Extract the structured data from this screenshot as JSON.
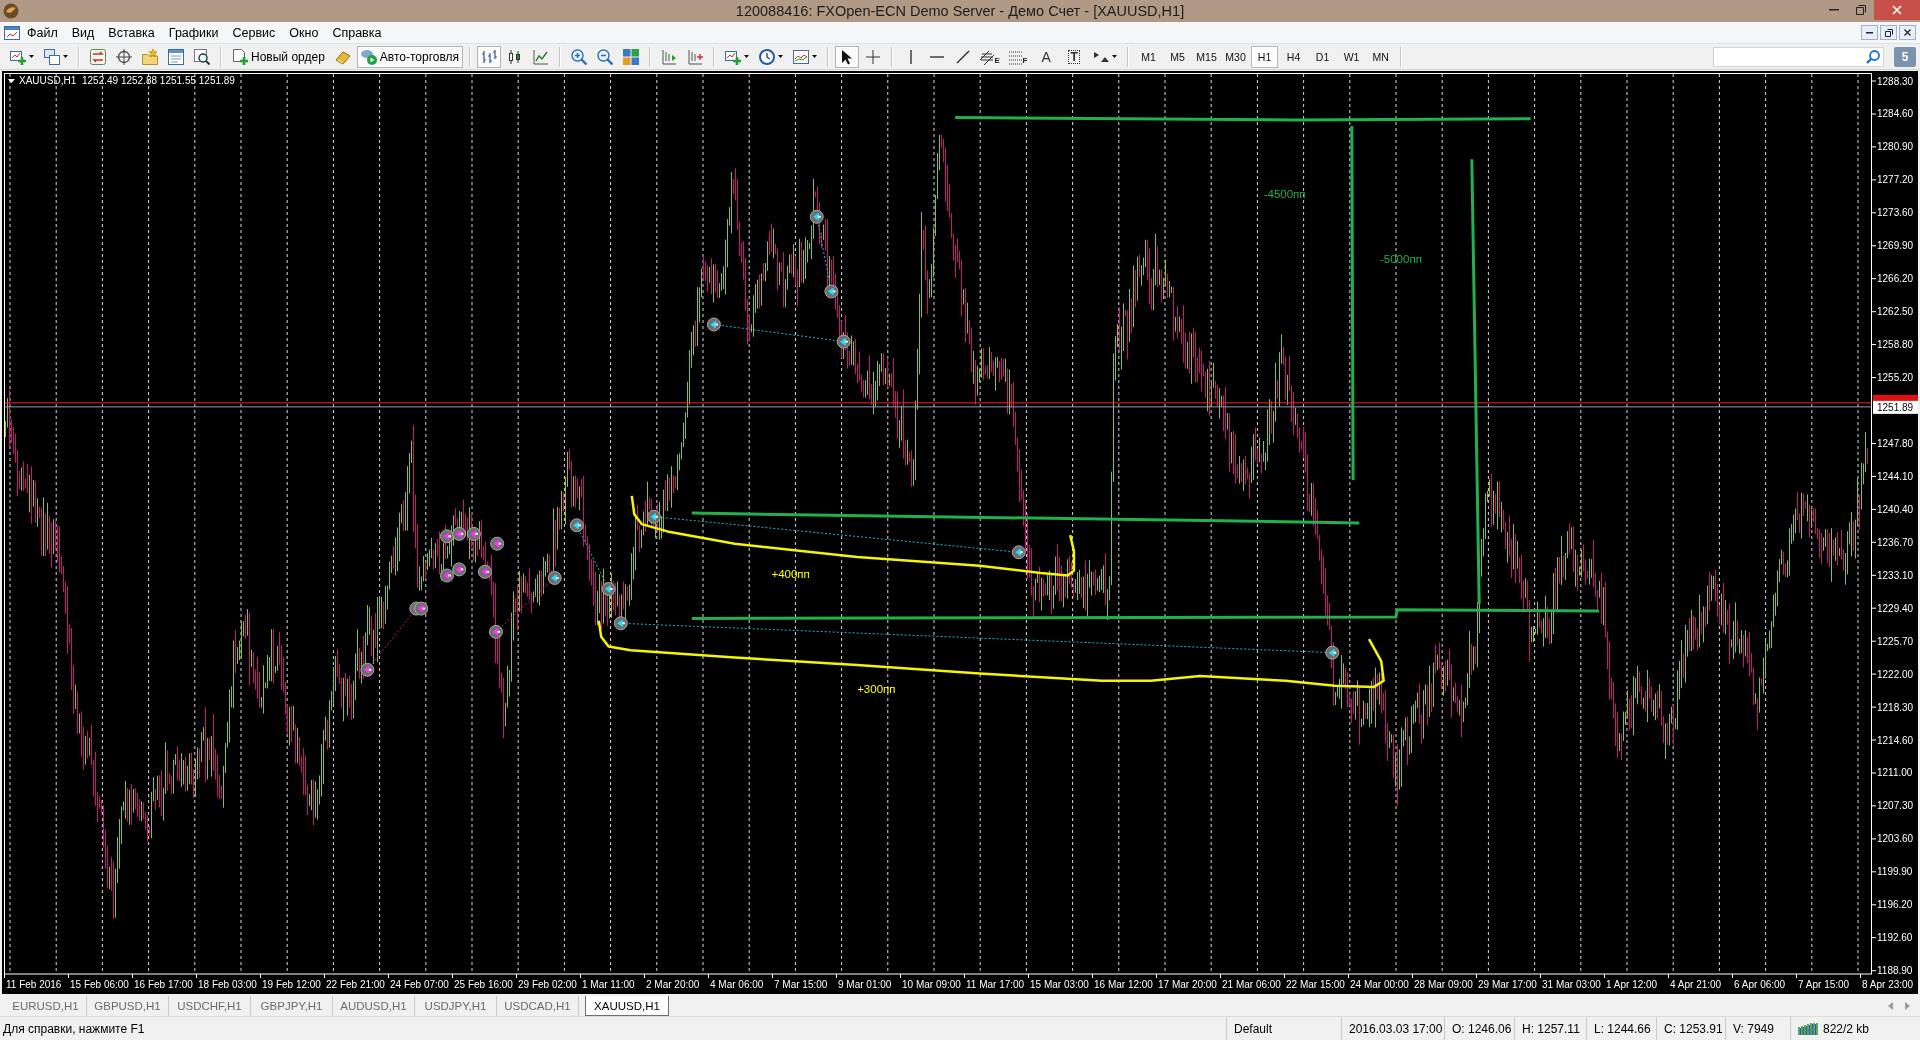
{
  "window": {
    "title": "120088416: FXOpen-ECN Demo Server - Демо Счет - [XAUUSD,H1]"
  },
  "menu": [
    "Файл",
    "Вид",
    "Вставка",
    "Графики",
    "Сервис",
    "Окно",
    "Справка"
  ],
  "toolbar": {
    "new_order": "Новый ордер",
    "auto_trading": {
      "label": "Авто-торговля",
      "on": true
    },
    "chart_modes": [
      {
        "selected": true
      },
      {
        "selected": false
      },
      {
        "selected": false
      }
    ],
    "cursor_modes": [
      {
        "selected": true
      },
      {
        "selected": false
      }
    ],
    "tool_letters": [
      "E",
      "F",
      "A",
      "T"
    ],
    "timeframes": [
      {
        "label": "M1",
        "selected": false
      },
      {
        "label": "M5",
        "selected": false
      },
      {
        "label": "M15",
        "selected": false
      },
      {
        "label": "M30",
        "selected": false
      },
      {
        "label": "H1",
        "selected": true
      },
      {
        "label": "H4",
        "selected": false
      },
      {
        "label": "D1",
        "selected": false
      },
      {
        "label": "W1",
        "selected": false
      },
      {
        "label": "MN",
        "selected": false
      }
    ],
    "messages": "5"
  },
  "chart": {
    "symbol": "XAUUSD,H1",
    "quote": "1252.49 1252.88 1251.55 1251.89",
    "price_labels": [
      "1288.30",
      "1284.60",
      "1280.90",
      "1277.20",
      "1273.60",
      "1269.90",
      "1266.20",
      "1262.50",
      "1258.80",
      "1255.20",
      "1247.80",
      "1244.10",
      "1240.40",
      "1236.70",
      "1233.10",
      "1229.40",
      "1225.70",
      "1222.00",
      "1218.30",
      "1214.60",
      "1211.00",
      "1207.30",
      "1203.60",
      "1199.90",
      "1196.20",
      "1192.60",
      "1188.90"
    ],
    "current_price": "1251.89",
    "time_labels": [
      "11 Feb 2016",
      "15 Feb 06:00",
      "16 Feb 17:00",
      "18 Feb 03:00",
      "19 Feb 12:00",
      "22 Feb 21:00",
      "24 Feb 07:00",
      "25 Feb 16:00",
      "29 Feb 02:00",
      "1 Mar 11:00",
      "2 Mar 20:00",
      "4 Mar 06:00",
      "7 Mar 15:00",
      "9 Mar 01:00",
      "10 Mar 09:00",
      "11 Mar 17:00",
      "15 Mar 03:00",
      "16 Mar 12:00",
      "17 Mar 20:00",
      "21 Mar 06:00",
      "22 Mar 15:00",
      "24 Mar 00:00",
      "28 Mar 09:00",
      "29 Mar 17:00",
      "31 Mar 03:00",
      "1 Apr 12:00",
      "4 Apr 21:00",
      "6 Apr 06:00",
      "7 Apr 15:00",
      "8 Apr 23:00"
    ],
    "annotations": [
      {
        "text": "-4500пп",
        "color": "#22b14c"
      },
      {
        "text": "-5000пп",
        "color": "#22b14c"
      },
      {
        "text": "+400пп",
        "color": "#ffff00"
      },
      {
        "text": "+300пп",
        "color": "#ffff00"
      }
    ]
  },
  "tabs": [
    {
      "label": "EURUSD,H1",
      "selected": false
    },
    {
      "label": "GBPUSD,H1",
      "selected": false
    },
    {
      "label": "USDCHF,H1",
      "selected": false
    },
    {
      "label": "GBPJPY,H1",
      "selected": false
    },
    {
      "label": "AUDUSD,H1",
      "selected": false
    },
    {
      "label": "USDJPY,H1",
      "selected": false
    },
    {
      "label": "USDCAD,H1",
      "selected": false
    },
    {
      "label": "XAUUSD,H1",
      "selected": true
    }
  ],
  "status_bar": {
    "help": "Для справки, нажмите F1",
    "profile": "Default",
    "datetime": "2016.03.03 17:00",
    "open": "O: 1246.06",
    "high": "H: 1257.11",
    "low": "L: 1244.66",
    "close": "C: 1253.91",
    "volume": "V: 7949",
    "traffic": "822/2 kb"
  }
}
